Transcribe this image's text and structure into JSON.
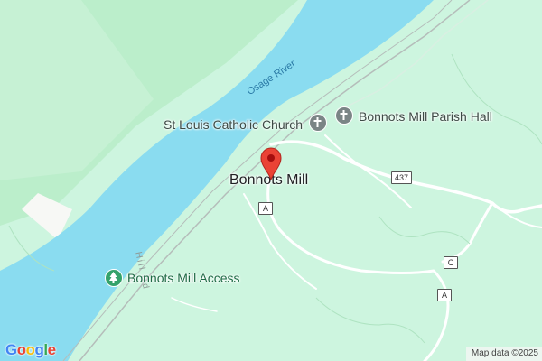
{
  "map": {
    "place_label": "Bonnots Mill",
    "river_label": "Osage River",
    "road_label": "Hill Rd",
    "pois": [
      {
        "name": "St Louis Catholic Church",
        "icon": "church-cross-icon"
      },
      {
        "name": "Bonnots Mill Parish Hall",
        "icon": "church-cross-icon"
      },
      {
        "name": "Bonnots Mill Access",
        "icon": "park-tree-icon"
      }
    ],
    "route_shields": [
      "437",
      "A",
      "C",
      "A"
    ],
    "logo": "Google",
    "attribution": "Map data ©2025",
    "colors": {
      "land": "#cdf5df",
      "river": "#8adcf0",
      "forest": "#bbeecb",
      "road": "#ffffff",
      "railway": "#b5bdba",
      "marker": "#ea4335"
    }
  }
}
